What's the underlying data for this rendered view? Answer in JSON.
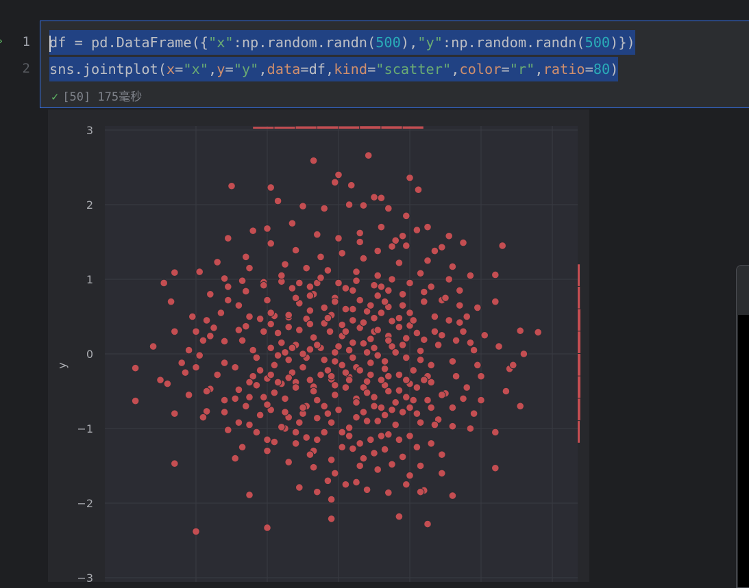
{
  "editor": {
    "line_numbers": [
      "1",
      "2"
    ],
    "line1": {
      "t1": "df = pd.DataFrame({",
      "s1": "\"x\"",
      "t2": ":np.random.randn(",
      "n1": "500",
      "t3": "),",
      "s2": "\"y\"",
      "t4": ":np.random.randn(",
      "n2": "500",
      "t5": ")})"
    },
    "line2": {
      "t1": "sns.jointplot(",
      "k1": "x",
      "t2": "=",
      "s1": "\"x\"",
      "t3": ",",
      "k2": "y",
      "t4": "=",
      "s2": "\"y\"",
      "t5": ",",
      "k3": "data",
      "t6": "=df,",
      "k4": "kind",
      "t7": "=",
      "s3": "\"scatter\"",
      "t8": ",",
      "k5": "color",
      "t9": "=",
      "s4": "\"r\"",
      "t10": ",",
      "k6": "ratio",
      "t11": "=",
      "n1": "80",
      "t12": ")"
    },
    "status": {
      "icon": "check-icon",
      "text": "[50] 175毫秒"
    }
  },
  "colors": {
    "background": "#1e1f22",
    "plot_bg": "#2b2c33",
    "marker": "#c44e52",
    "marker_edge": "#2b2c33",
    "selection": "#214283",
    "accent": "#3574f0"
  },
  "chart_data": {
    "type": "scatter",
    "xlabel": "",
    "ylabel": "y",
    "ylim": [
      -3,
      3.05
    ],
    "xlim": [
      -3.2,
      3.5
    ],
    "yticks": [
      3,
      2,
      1,
      0,
      -1,
      -2,
      -3
    ],
    "yticklabels": [
      "3",
      "2",
      "1",
      "0",
      "−1",
      "−2",
      "−3"
    ],
    "grid": true,
    "marginal_x": {
      "type": "histogram",
      "placement": "top"
    },
    "marginal_y": {
      "type": "histogram",
      "placement": "right"
    },
    "points": [
      [
        0.42,
        2.66
      ],
      [
        -0.35,
        2.59
      ],
      [
        -0.95,
        2.23
      ],
      [
        0.18,
        2.26
      ],
      [
        -0.05,
        2.3
      ],
      [
        0.0,
        2.4
      ],
      [
        1.12,
        2.2
      ],
      [
        1.0,
        2.36
      ],
      [
        -1.5,
        2.25
      ],
      [
        -0.85,
        2.05
      ],
      [
        0.35,
        1.99
      ],
      [
        0.6,
        2.09
      ],
      [
        0.7,
        1.95
      ],
      [
        1.1,
        1.66
      ],
      [
        1.25,
        1.7
      ],
      [
        1.75,
        1.49
      ],
      [
        2.2,
        1.06
      ],
      [
        2.55,
        0.31
      ],
      [
        0.8,
        1.52
      ],
      [
        0.9,
        1.58
      ],
      [
        1.45,
        1.43
      ],
      [
        -1.7,
        1.23
      ],
      [
        -1.2,
        1.65
      ],
      [
        -1.0,
        1.68
      ],
      [
        -0.6,
        1.39
      ],
      [
        -0.25,
        1.3
      ],
      [
        0.3,
        1.5
      ],
      [
        0.55,
        1.38
      ],
      [
        0.75,
        1.44
      ],
      [
        1.35,
        1.38
      ],
      [
        1.6,
        1.17
      ],
      [
        1.85,
        1.05
      ],
      [
        -2.3,
        1.09
      ],
      [
        -1.95,
        1.1
      ],
      [
        -1.6,
        1.01
      ],
      [
        -1.3,
        0.84
      ],
      [
        -1.05,
        0.96
      ],
      [
        -0.8,
        0.97
      ],
      [
        -0.4,
        0.9
      ],
      [
        0.1,
        0.88
      ],
      [
        0.55,
        0.78
      ],
      [
        0.9,
        0.8
      ],
      [
        1.2,
        0.83
      ],
      [
        1.45,
        0.72
      ],
      [
        1.7,
        0.65
      ],
      [
        1.95,
        0.62
      ],
      [
        -2.3,
        0.3
      ],
      [
        -2.05,
        0.5
      ],
      [
        -1.8,
        0.24
      ],
      [
        -1.6,
        0.17
      ],
      [
        -1.3,
        0.37
      ],
      [
        -1.1,
        0.47
      ],
      [
        -0.9,
        0.51
      ],
      [
        -0.7,
        0.49
      ],
      [
        -0.45,
        0.47
      ],
      [
        -0.2,
        0.41
      ],
      [
        0.05,
        0.39
      ],
      [
        0.3,
        0.35
      ],
      [
        0.5,
        0.3
      ],
      [
        0.7,
        0.24
      ],
      [
        0.95,
        0.21
      ],
      [
        1.2,
        0.19
      ],
      [
        1.45,
        0.25
      ],
      [
        1.65,
        0.18
      ],
      [
        2.25,
        0.1
      ],
      [
        2.8,
        0.29
      ],
      [
        -2.85,
        -0.19
      ],
      [
        -2.2,
        -0.12
      ],
      [
        -2.15,
        -0.25
      ],
      [
        -1.8,
        -0.47
      ],
      [
        -1.6,
        -0.62
      ],
      [
        -1.4,
        -0.48
      ],
      [
        -1.2,
        -0.3
      ],
      [
        -1.0,
        -0.33
      ],
      [
        -0.8,
        -0.4
      ],
      [
        -0.6,
        -0.38
      ],
      [
        -0.35,
        -0.44
      ],
      [
        -0.1,
        -0.34
      ],
      [
        0.15,
        -0.31
      ],
      [
        0.4,
        -0.37
      ],
      [
        0.65,
        -0.42
      ],
      [
        0.85,
        -0.49
      ],
      [
        1.1,
        -0.45
      ],
      [
        1.3,
        -0.38
      ],
      [
        1.5,
        -0.53
      ],
      [
        1.75,
        -0.6
      ],
      [
        2.0,
        -0.62
      ],
      [
        2.4,
        -0.2
      ],
      [
        -2.85,
        -0.63
      ],
      [
        -2.1,
        -0.55
      ],
      [
        -1.85,
        -0.77
      ],
      [
        -1.55,
        -1.02
      ],
      [
        -1.25,
        -0.95
      ],
      [
        -0.95,
        -0.75
      ],
      [
        -0.7,
        -0.85
      ],
      [
        -0.5,
        -0.8
      ],
      [
        -0.3,
        -0.86
      ],
      [
        -0.1,
        -0.92
      ],
      [
        0.15,
        -0.99
      ],
      [
        0.4,
        -0.9
      ],
      [
        0.65,
        -0.82
      ],
      [
        0.9,
        -0.78
      ],
      [
        1.15,
        -0.92
      ],
      [
        1.4,
        -0.88
      ],
      [
        1.6,
        -0.97
      ],
      [
        1.85,
        -1.0
      ],
      [
        2.2,
        -1.05
      ],
      [
        -2.3,
        -1.47
      ],
      [
        -0.6,
        -1.2
      ],
      [
        -0.35,
        -1.3
      ],
      [
        -0.1,
        -1.42
      ],
      [
        0.2,
        -1.27
      ],
      [
        0.5,
        -1.33
      ],
      [
        0.75,
        -1.48
      ],
      [
        1.0,
        -1.63
      ],
      [
        1.2,
        -1.83
      ],
      [
        1.45,
        -1.6
      ],
      [
        2.2,
        -1.53
      ],
      [
        -1.25,
        -1.89
      ],
      [
        -0.55,
        -1.79
      ],
      [
        -0.3,
        -1.85
      ],
      [
        -0.1,
        -1.95
      ],
      [
        0.25,
        -1.72
      ],
      [
        0.7,
        -1.86
      ],
      [
        0.95,
        -1.75
      ],
      [
        1.15,
        -1.85
      ],
      [
        1.6,
        -1.9
      ],
      [
        -2.0,
        -2.38
      ],
      [
        -1.0,
        -2.33
      ],
      [
        -0.1,
        -2.21
      ],
      [
        0.85,
        -2.18
      ],
      [
        1.25,
        -2.28
      ],
      [
        -0.6,
        0.12
      ],
      [
        -0.45,
        -0.05
      ],
      [
        -0.25,
        0.08
      ],
      [
        -0.05,
        -0.1
      ],
      [
        0.15,
        0.05
      ],
      [
        0.35,
        0.14
      ],
      [
        0.55,
        -0.02
      ],
      [
        0.75,
        0.1
      ],
      [
        0.95,
        -0.05
      ],
      [
        1.15,
        0.04
      ],
      [
        -0.75,
        0.02
      ],
      [
        -0.95,
        0.08
      ],
      [
        -1.15,
        -0.05
      ],
      [
        -0.35,
        0.22
      ],
      [
        0.05,
        0.24
      ],
      [
        0.45,
        0.2
      ],
      [
        0.25,
        -0.18
      ],
      [
        -0.15,
        -0.22
      ],
      [
        0.65,
        -0.2
      ],
      [
        -0.5,
        -0.18
      ],
      [
        1.3,
        -0.15
      ],
      [
        -1.45,
        -0.18
      ],
      [
        0.85,
        0.36
      ],
      [
        -0.85,
        0.28
      ],
      [
        0.1,
        0.6
      ],
      [
        -0.2,
        0.62
      ],
      [
        0.4,
        0.57
      ],
      [
        0.7,
        0.63
      ],
      [
        -0.55,
        0.68
      ],
      [
        1.0,
        0.55
      ],
      [
        1.35,
        0.5
      ],
      [
        -1.0,
        0.72
      ],
      [
        -1.4,
        0.65
      ],
      [
        1.55,
        0.45
      ],
      [
        -1.65,
        0.55
      ],
      [
        1.75,
        0.3
      ],
      [
        -0.05,
        -0.55
      ],
      [
        0.25,
        -0.6
      ],
      [
        0.5,
        -0.58
      ],
      [
        -0.3,
        -0.62
      ],
      [
        0.8,
        -0.65
      ],
      [
        -0.75,
        -0.6
      ],
      [
        1.05,
        -0.62
      ],
      [
        -1.05,
        -0.58
      ],
      [
        1.3,
        -0.72
      ],
      [
        -1.3,
        -0.7
      ],
      [
        0.0,
        -0.75
      ],
      [
        0.35,
        -0.78
      ],
      [
        -0.45,
        -0.7
      ],
      [
        0.6,
        -0.72
      ],
      [
        0.95,
        -0.58
      ],
      [
        -0.9,
        -0.52
      ],
      [
        1.9,
        0.05
      ],
      [
        -1.95,
        -0.02
      ],
      [
        2.0,
        -0.3
      ],
      [
        -2.1,
        0.05
      ],
      [
        1.55,
        1.0
      ],
      [
        -1.55,
        0.9
      ],
      [
        0.25,
        1.1
      ],
      [
        -0.15,
        1.12
      ],
      [
        0.55,
        1.05
      ],
      [
        -0.45,
        1.15
      ],
      [
        0.85,
        1.22
      ],
      [
        -0.75,
        1.2
      ],
      [
        1.15,
        1.08
      ],
      [
        -1.25,
        1.15
      ],
      [
        0.05,
        1.35
      ],
      [
        0.35,
        1.28
      ],
      [
        -0.05,
        0.75
      ],
      [
        0.3,
        0.72
      ],
      [
        -0.35,
        0.8
      ],
      [
        0.6,
        0.9
      ],
      [
        -0.65,
        0.88
      ],
      [
        0.2,
        0.45
      ],
      [
        -0.1,
        0.52
      ],
      [
        0.5,
        0.48
      ],
      [
        -0.4,
        0.4
      ],
      [
        0.75,
        0.44
      ],
      [
        -0.7,
        0.36
      ],
      [
        1.0,
        0.38
      ],
      [
        0.45,
        -0.12
      ],
      [
        -0.2,
        -0.08
      ],
      [
        0.1,
        -0.25
      ],
      [
        -0.65,
        -0.25
      ],
      [
        0.85,
        -0.28
      ],
      [
        1.05,
        -0.22
      ],
      [
        -0.9,
        -0.15
      ],
      [
        1.25,
        -0.3
      ],
      [
        -1.1,
        -0.22
      ],
      [
        0.35,
        -0.45
      ],
      [
        -0.05,
        -0.42
      ],
      [
        0.6,
        -0.35
      ],
      [
        -0.25,
        -0.28
      ],
      [
        0.0,
        0.1
      ],
      [
        0.2,
        0.15
      ],
      [
        -0.3,
        0.12
      ],
      [
        0.4,
        0.02
      ],
      [
        -0.5,
        0.0
      ],
      [
        0.7,
        0.18
      ],
      [
        -0.7,
        -0.08
      ],
      [
        1.4,
        0.12
      ],
      [
        -1.35,
        0.18
      ],
      [
        1.6,
        -0.1
      ],
      [
        -1.6,
        -0.12
      ],
      [
        0.15,
        -1.1
      ],
      [
        -0.2,
        -1.05
      ],
      [
        0.45,
        -1.15
      ],
      [
        -0.45,
        -1.12
      ],
      [
        0.7,
        -1.08
      ],
      [
        -0.75,
        -1.0
      ],
      [
        1.0,
        -1.1
      ],
      [
        -1.0,
        -1.15
      ],
      [
        0.3,
        -1.5
      ],
      [
        -0.05,
        -1.6
      ],
      [
        0.55,
        -1.55
      ],
      [
        -0.35,
        -1.52
      ],
      [
        1.3,
        -1.2
      ],
      [
        -1.35,
        -1.25
      ],
      [
        2.35,
        -0.5
      ],
      [
        -2.4,
        -0.4
      ],
      [
        2.6,
        0.0
      ],
      [
        -2.6,
        0.1
      ],
      [
        1.9,
        -0.8
      ],
      [
        -1.9,
        -0.85
      ],
      [
        1.7,
        0.85
      ],
      [
        -1.8,
        0.8
      ],
      [
        0.95,
        1.85
      ],
      [
        -0.5,
        1.98
      ],
      [
        2.2,
        0.7
      ],
      [
        -2.35,
        0.7
      ],
      [
        1.45,
        -1.35
      ],
      [
        -1.45,
        -1.4
      ],
      [
        0.05,
        -0.15
      ],
      [
        0.3,
        -0.22
      ],
      [
        -0.12,
        0.3
      ],
      [
        0.55,
        0.32
      ],
      [
        -0.55,
        0.32
      ],
      [
        0.8,
        0.02
      ],
      [
        -0.8,
        0.15
      ],
      [
        1.1,
        0.28
      ],
      [
        -1.05,
        0.3
      ],
      [
        0.2,
        0.85
      ],
      [
        -0.3,
        0.95
      ],
      [
        0.65,
        0.7
      ],
      [
        -0.6,
        0.75
      ],
      [
        0.9,
        0.65
      ],
      [
        -0.95,
        0.55
      ],
      [
        1.2,
        0.7
      ],
      [
        -1.25,
        0.5
      ],
      [
        0.1,
        -0.45
      ],
      [
        -0.35,
        -0.5
      ],
      [
        0.4,
        -0.52
      ],
      [
        -0.6,
        -0.45
      ],
      [
        0.7,
        -0.5
      ],
      [
        -0.85,
        -0.38
      ],
      [
        1.0,
        -0.4
      ],
      [
        -1.15,
        -0.42
      ],
      [
        0.25,
        -0.85
      ],
      [
        -0.15,
        -0.8
      ],
      [
        0.55,
        -0.9
      ],
      [
        -0.55,
        -0.92
      ],
      [
        0.8,
        -0.95
      ],
      [
        -0.8,
        -0.98
      ],
      [
        1.1,
        -0.8
      ],
      [
        -1.1,
        -0.82
      ],
      [
        1.45,
        -0.55
      ],
      [
        -1.45,
        -0.6
      ],
      [
        1.65,
        -0.3
      ],
      [
        -1.7,
        -0.28
      ],
      [
        1.8,
        0.5
      ],
      [
        -1.85,
        0.45
      ],
      [
        2.05,
        0.25
      ],
      [
        -2.0,
        0.3
      ],
      [
        0.0,
        1.55
      ],
      [
        0.3,
        1.62
      ],
      [
        -0.3,
        1.6
      ],
      [
        0.6,
        1.7
      ],
      [
        -0.65,
        1.75
      ],
      [
        0.95,
        1.45
      ],
      [
        -0.95,
        1.48
      ],
      [
        1.25,
        1.25
      ],
      [
        -1.3,
        1.3
      ],
      [
        0.15,
        2.0
      ],
      [
        -0.2,
        1.95
      ],
      [
        0.5,
        2.1
      ],
      [
        1.55,
        1.58
      ],
      [
        -1.55,
        1.55
      ],
      [
        2.3,
        1.45
      ],
      [
        -2.45,
        0.95
      ],
      [
        2.45,
        -0.15
      ],
      [
        -2.5,
        -0.35
      ],
      [
        2.55,
        -0.7
      ],
      [
        -2.3,
        -0.8
      ],
      [
        0.05,
        -1.25
      ],
      [
        -0.4,
        -1.35
      ],
      [
        0.35,
        -1.4
      ],
      [
        0.65,
        -1.28
      ],
      [
        -0.7,
        -1.45
      ],
      [
        0.9,
        -1.38
      ],
      [
        -1.0,
        -1.3
      ],
      [
        1.15,
        -1.5
      ],
      [
        0.1,
        -1.75
      ],
      [
        -0.15,
        -1.7
      ],
      [
        0.4,
        -1.82
      ],
      [
        0.2,
        -0.05
      ],
      [
        -0.05,
        0.02
      ],
      [
        0.5,
        0.08
      ],
      [
        -0.4,
        0.06
      ],
      [
        0.65,
        -0.1
      ],
      [
        -0.65,
        0.08
      ],
      [
        0.9,
        0.12
      ],
      [
        -0.85,
        -0.02
      ],
      [
        1.15,
        -0.08
      ],
      [
        -1.2,
        0.05
      ],
      [
        1.35,
        0.3
      ],
      [
        -1.4,
        0.32
      ],
      [
        0.1,
        0.3
      ],
      [
        0.35,
        0.42
      ],
      [
        -0.15,
        0.48
      ],
      [
        0.6,
        0.55
      ],
      [
        -0.4,
        0.58
      ],
      [
        0.85,
        0.48
      ],
      [
        -0.7,
        0.52
      ],
      [
        1.05,
        0.45
      ],
      [
        -0.95,
        0.4
      ],
      [
        0.15,
        -0.35
      ],
      [
        -0.1,
        -0.3
      ],
      [
        0.45,
        -0.28
      ],
      [
        -0.4,
        -0.35
      ],
      [
        0.7,
        -0.3
      ],
      [
        -0.7,
        -0.32
      ],
      [
        0.95,
        -0.35
      ],
      [
        -0.95,
        -0.28
      ],
      [
        1.2,
        -0.35
      ],
      [
        -1.25,
        -0.38
      ],
      [
        0.25,
        -0.65
      ],
      [
        -0.2,
        -0.7
      ],
      [
        0.5,
        -0.7
      ],
      [
        -0.5,
        -0.72
      ],
      [
        0.75,
        -0.75
      ],
      [
        -0.75,
        -0.78
      ],
      [
        1.0,
        -0.72
      ],
      [
        -1.0,
        -0.68
      ],
      [
        1.25,
        -0.62
      ],
      [
        -1.25,
        -0.58
      ],
      [
        0.0,
        0.95
      ],
      [
        0.25,
        0.98
      ],
      [
        -0.25,
        1.02
      ],
      [
        0.5,
        0.92
      ],
      [
        -0.55,
        0.95
      ],
      [
        0.75,
        1.0
      ],
      [
        -0.8,
        1.05
      ],
      [
        1.0,
        0.95
      ],
      [
        -1.05,
        0.92
      ],
      [
        1.3,
        0.9
      ],
      [
        -1.35,
        0.98
      ],
      [
        1.5,
        0.75
      ],
      [
        -1.55,
        0.72
      ],
      [
        1.7,
        0.42
      ],
      [
        -1.75,
        0.35
      ],
      [
        1.85,
        0.15
      ],
      [
        -1.9,
        0.18
      ],
      [
        1.95,
        -0.15
      ],
      [
        -2.0,
        -0.18
      ],
      [
        1.8,
        -0.45
      ],
      [
        -1.85,
        -0.5
      ],
      [
        1.6,
        -0.72
      ],
      [
        -1.6,
        -0.78
      ],
      [
        1.35,
        -0.95
      ],
      [
        -1.4,
        -0.92
      ],
      [
        1.1,
        -1.25
      ],
      [
        -1.15,
        -1.05
      ],
      [
        0.85,
        -1.15
      ],
      [
        -0.9,
        -1.18
      ],
      [
        0.6,
        -1.1
      ],
      [
        -0.6,
        -1.05
      ],
      [
        0.3,
        -1.2
      ],
      [
        -0.3,
        -1.15
      ],
      [
        0.05,
        -1.05
      ],
      [
        0.45,
        0.65
      ],
      [
        -0.05,
        0.7
      ],
      [
        0.2,
        0.6
      ],
      [
        0.7,
        0.85
      ],
      [
        -0.4,
        0.78
      ]
    ]
  }
}
